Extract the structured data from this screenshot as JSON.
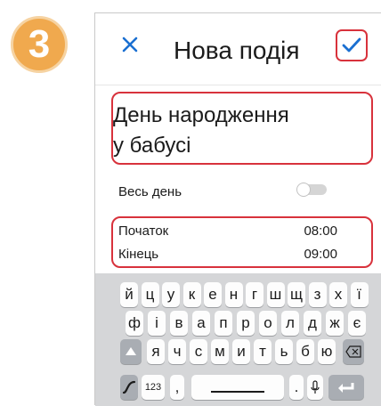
{
  "step": {
    "number": "3"
  },
  "header": {
    "title": "Нова подія",
    "close_icon": "close-icon",
    "confirm_icon": "check-icon"
  },
  "event": {
    "name_line1": "День народження",
    "name_line2": "у бабусі"
  },
  "all_day": {
    "label": "Весь день",
    "enabled": false
  },
  "times": {
    "start_label": "Початок",
    "start_value": "08:00",
    "end_label": "Кінець",
    "end_value": "09:00"
  },
  "keyboard": {
    "row1": [
      "й",
      "ц",
      "у",
      "к",
      "е",
      "н",
      "г",
      "ш",
      "щ",
      "з",
      "х",
      "ї"
    ],
    "row2": [
      "ф",
      "і",
      "в",
      "а",
      "п",
      "р",
      "о",
      "л",
      "д",
      "ж",
      "є"
    ],
    "row3": [
      "я",
      "ч",
      "с",
      "м",
      "и",
      "т",
      "ь",
      "б",
      "ю"
    ],
    "numbers_key": "123",
    "comma_key": ",",
    "period_key": "."
  },
  "colors": {
    "accent": "#1a6fd1",
    "highlight": "#d8323c",
    "badge": "#f0a94e"
  }
}
